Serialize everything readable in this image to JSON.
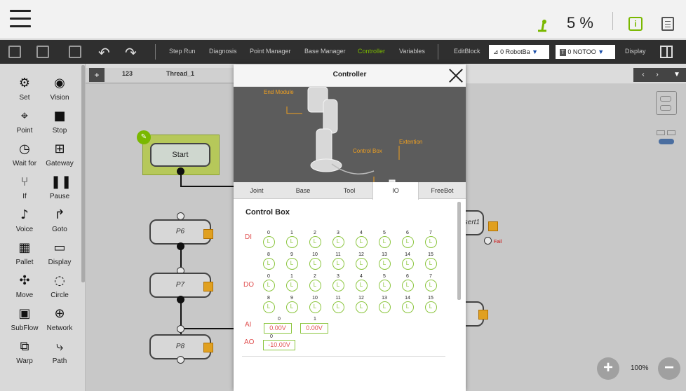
{
  "topbar": {
    "speed": "5 %"
  },
  "toolbar": {
    "items": [
      {
        "label": "Step Run",
        "active": false
      },
      {
        "label": "Diagnosis",
        "active": false
      },
      {
        "label": "Point Manager",
        "active": false
      },
      {
        "label": "Base Manager",
        "active": false
      },
      {
        "label": "Controller",
        "active": true
      },
      {
        "label": "Variables",
        "active": false
      }
    ],
    "editblock": "EditBlock",
    "base_select": "0 RobotBa",
    "tool_tag": "T",
    "tool_select": "0 NOTOO",
    "display": "Display"
  },
  "palette": [
    {
      "label": "Set",
      "icon": "set-icon"
    },
    {
      "label": "Vision",
      "icon": "eye-icon"
    },
    {
      "label": "Point",
      "icon": "point-icon"
    },
    {
      "label": "Stop",
      "icon": "stop-icon"
    },
    {
      "label": "Wait for",
      "icon": "clock-icon"
    },
    {
      "label": "Gateway",
      "icon": "gateway-icon"
    },
    {
      "label": "If",
      "icon": "if-icon"
    },
    {
      "label": "Pause",
      "icon": "pause-icon"
    },
    {
      "label": "Voice",
      "icon": "voice-icon"
    },
    {
      "label": "Goto",
      "icon": "goto-icon"
    },
    {
      "label": "Pallet",
      "icon": "pallet-icon"
    },
    {
      "label": "Display",
      "icon": "display-icon"
    },
    {
      "label": "Move",
      "icon": "move-icon"
    },
    {
      "label": "Circle",
      "icon": "circle-icon"
    },
    {
      "label": "SubFlow",
      "icon": "subflow-icon"
    },
    {
      "label": "Network",
      "icon": "network-icon"
    },
    {
      "label": "Warp",
      "icon": "warp-icon"
    },
    {
      "label": "Path",
      "icon": "path-icon"
    }
  ],
  "canvas": {
    "tab_add": "+",
    "tabs": [
      "123",
      "Thread_1"
    ],
    "start": "Start",
    "nodes": [
      "P6",
      "P7",
      "P8"
    ],
    "right_nodes": [
      "nsert1"
    ],
    "fail_label": "Fail",
    "zoom": "100%"
  },
  "modal": {
    "title": "Controller",
    "robot_labels": {
      "end_module": "End Module",
      "control_box": "Control Box",
      "extention": "Extention"
    },
    "tabs": [
      {
        "label": "Joint",
        "active": false
      },
      {
        "label": "Base",
        "active": false
      },
      {
        "label": "Tool",
        "active": false
      },
      {
        "label": "IO",
        "active": true
      },
      {
        "label": "FreeBot",
        "active": false
      }
    ],
    "section": "Control Box",
    "di_label": "DI",
    "do_label": "DO",
    "ai_label": "AI",
    "ao_label": "AO",
    "io_state": "L",
    "di": {
      "row1": [
        "0",
        "1",
        "2",
        "3",
        "4",
        "5",
        "6",
        "7"
      ],
      "row2": [
        "8",
        "9",
        "10",
        "11",
        "12",
        "13",
        "14",
        "15"
      ]
    },
    "do": {
      "row1": [
        "0",
        "1",
        "2",
        "3",
        "4",
        "5",
        "6",
        "7"
      ],
      "row2": [
        "8",
        "9",
        "10",
        "11",
        "12",
        "13",
        "14",
        "15"
      ]
    },
    "ai": [
      {
        "idx": "0",
        "value": "0.00V"
      },
      {
        "idx": "1",
        "value": "0.00V"
      }
    ],
    "ao": [
      {
        "idx": "0",
        "value": "-10.00V"
      }
    ]
  }
}
